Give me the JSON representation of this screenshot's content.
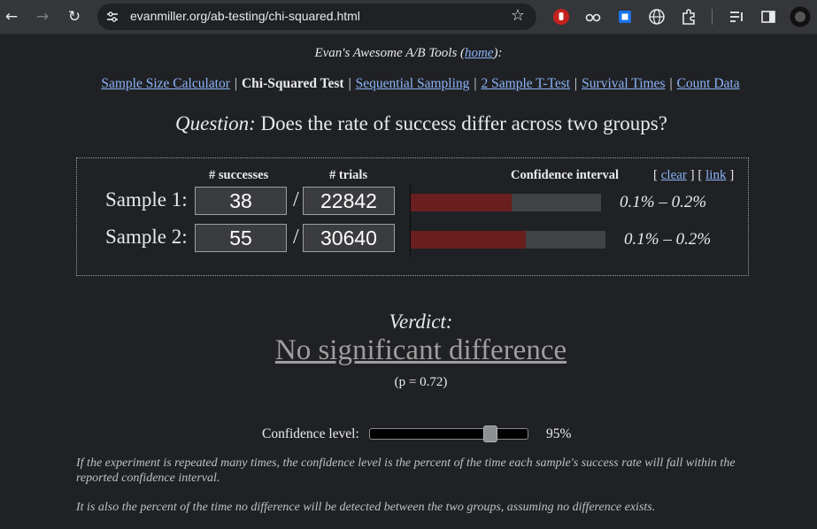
{
  "browser": {
    "url": "evanmiller.org/ab-testing/chi-squared.html"
  },
  "header": {
    "title_prefix": "Evan's Awesome A/B Tools (",
    "home_link": "home",
    "title_suffix": "):"
  },
  "nav": {
    "links": [
      {
        "label": "Sample Size Calculator",
        "current": false
      },
      {
        "label": "Chi-Squared Test",
        "current": true
      },
      {
        "label": "Sequential Sampling",
        "current": false
      },
      {
        "label": "2 Sample T-Test",
        "current": false
      },
      {
        "label": "Survival Times",
        "current": false
      },
      {
        "label": "Count Data",
        "current": false
      }
    ],
    "separator": "|"
  },
  "question": {
    "label": "Question:",
    "text": " Does the rate of success differ across two groups?"
  },
  "calculator": {
    "successes_header": "# successes",
    "trials_header": "# trials",
    "ci_header": "Confidence interval",
    "clear_link": "clear",
    "link_link": "link",
    "slash": "/",
    "samples": [
      {
        "label": "Sample 1:",
        "successes": "38",
        "trials": "22842",
        "ci_text": "0.1% – 0.2%",
        "bar_fill_pct": 53
      },
      {
        "label": "Sample 2:",
        "successes": "55",
        "trials": "30640",
        "ci_text": "0.1% – 0.2%",
        "bar_fill_pct": 59
      }
    ]
  },
  "result": {
    "verdict_label": "Verdict:",
    "verdict": "No significant difference",
    "p_value": "(p = 0.72)"
  },
  "confidence": {
    "label": "Confidence level:",
    "value": "95%",
    "slider_position_pct": 79
  },
  "notes": [
    "If the experiment is repeated many times, the confidence level is the percent of the time each sample's success rate will fall within the reported confidence interval.",
    "It is also the percent of the time no difference will be detected between the two groups, assuming no difference exists."
  ],
  "colors": {
    "background": "#202124",
    "link": "#8ab4f8",
    "bar_fill": "#6b1e1e",
    "bar_track": "#3f4345"
  }
}
